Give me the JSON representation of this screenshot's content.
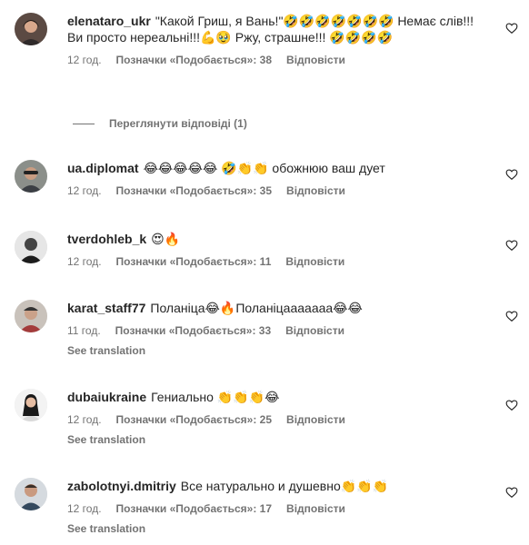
{
  "comments": [
    {
      "username": "elenataro_ukr",
      "text": "\"Какой Гриш, я Вань!\"🤣🤣🤣🤣🤣🤣🤣 Немає слів!!! Ви просто нереальні!!!💪🥹 Ржу, страшне!!! 🤣🤣🤣🤣",
      "time": "12 год.",
      "likes": "Позначки «Подобається»: 38",
      "reply": "Відповісти",
      "translation": ""
    },
    {
      "username": "ua.diplomat",
      "text": "😂😂😂😂😂 🤣👏👏 обожнюю ваш дует",
      "time": "12 год.",
      "likes": "Позначки «Подобається»: 35",
      "reply": "Відповісти",
      "translation": ""
    },
    {
      "username": "tverdohleb_k",
      "text": "😍🔥",
      "time": "12 год.",
      "likes": "Позначки «Подобається»: 11",
      "reply": "Відповісти",
      "translation": ""
    },
    {
      "username": "karat_staff77",
      "text": "Поланіца😂🔥Поланіцааааааа😂😂",
      "time": "11 год.",
      "likes": "Позначки «Подобається»: 33",
      "reply": "Відповісти",
      "translation": "See translation"
    },
    {
      "username": "dubaiukraine",
      "text": "Гениально 👏👏👏😂",
      "time": "12 год.",
      "likes": "Позначки «Подобається»: 25",
      "reply": "Відповісти",
      "translation": "See translation"
    },
    {
      "username": "zabolotnyi.dmitriy",
      "text": "Все натурально и душевно👏👏👏",
      "time": "12 год.",
      "likes": "Позначки «Подобається»: 17",
      "reply": "Відповісти",
      "translation": "See translation"
    }
  ],
  "view_replies": "Переглянути відповіді (1)",
  "icons": {
    "like": "heart-outline-icon"
  },
  "colors": {
    "text": "#262626",
    "secondary": "#737373"
  }
}
